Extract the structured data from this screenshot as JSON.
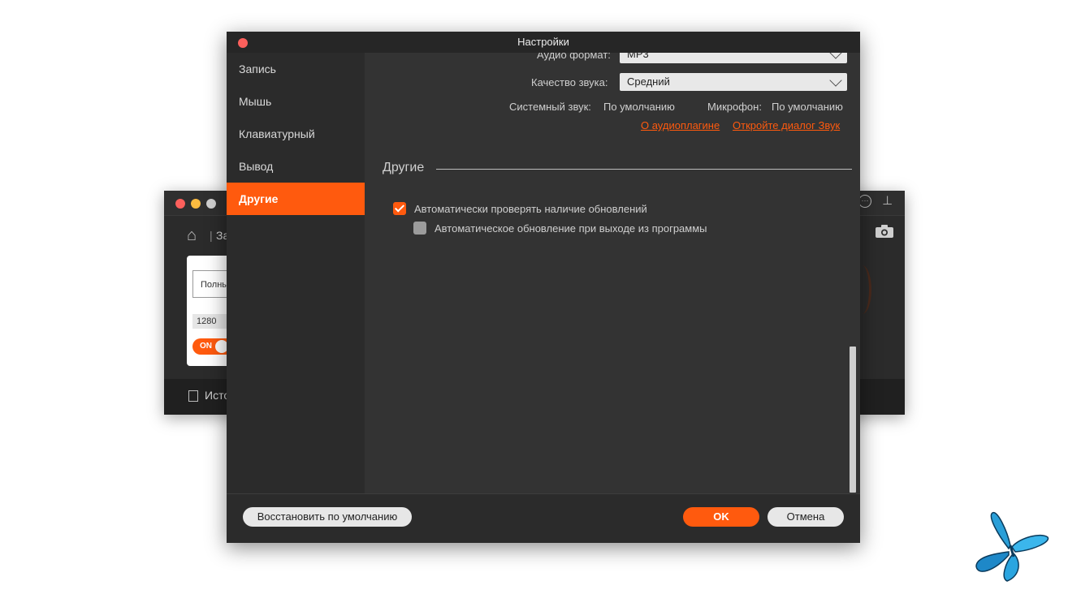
{
  "background_window": {
    "breadcrumb": "За",
    "card": {
      "mode_label": "Полны",
      "width_value": "1280",
      "toggle_label": "ON"
    },
    "bottom_label": "Исто"
  },
  "dialog": {
    "title": "Настройки",
    "sidebar": {
      "items": [
        {
          "label": "Запись"
        },
        {
          "label": "Мышь"
        },
        {
          "label": "Клавиатурный"
        },
        {
          "label": "Вывод"
        },
        {
          "label": "Другие"
        }
      ],
      "active_index": 4
    },
    "audio": {
      "format_label": "Аудио формат:",
      "format_value": "MP3",
      "quality_label": "Качество звука:",
      "quality_value": "Средний",
      "system_sound_label": "Системный звук:",
      "system_sound_value": "По умолчанию",
      "microphone_label": "Микрофон:",
      "microphone_value": "По умолчанию",
      "plugin_link": "О аудиоплагине",
      "sound_dialog_link": "Откройте диалог Звук"
    },
    "others": {
      "section_title": "Другие",
      "check_updates": {
        "label": "Автоматически проверять наличие обновлений",
        "checked": true
      },
      "auto_update_on_exit": {
        "label": "Автоматическое обновление при выходе из программы",
        "checked": false
      }
    },
    "footer": {
      "restore_label": "Восстановить по умолчанию",
      "ok_label": "OK",
      "cancel_label": "Отмена"
    }
  },
  "colors": {
    "accent": "#ff5a0e",
    "dialog_bg": "#333333",
    "sidebar_bg": "#2b2b2b",
    "close_button": "#fc605c"
  }
}
